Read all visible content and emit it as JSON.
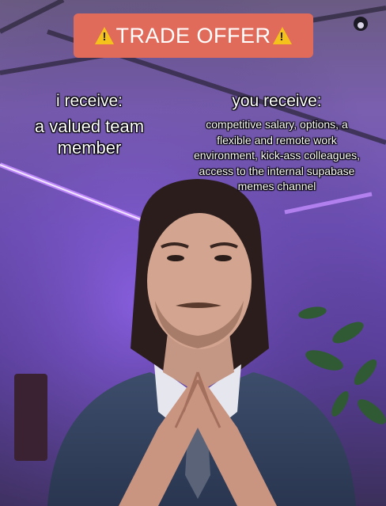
{
  "banner": {
    "left_icon": "warning-icon",
    "text": "TRADE OFFER",
    "right_icon": "warning-icon"
  },
  "left_panel": {
    "heading": "i receive:",
    "body": "a valued team member"
  },
  "right_panel": {
    "heading": "you receive:",
    "body": "competitive salary, options, a flexible and remote work environment, kick-ass colleagues, access to the internal supabase memes channel"
  },
  "colors": {
    "banner_background": "#e06b5b",
    "warning_yellow": "#f5c21b",
    "text": "#ffffff",
    "neon_purple": "#b06cff"
  }
}
